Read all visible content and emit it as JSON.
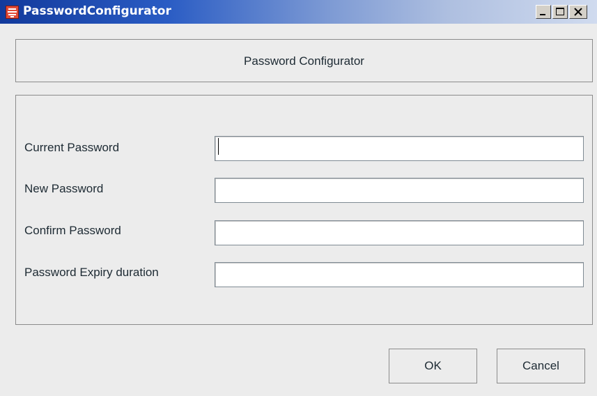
{
  "window": {
    "title": "PasswordConfigurator",
    "app_icon": "red-app-icon",
    "controls": {
      "minimize_icon": "minimize-icon",
      "maximize_icon": "maximize-icon",
      "close_icon": "close-icon"
    }
  },
  "header": {
    "title": "Password Configurator"
  },
  "form": {
    "fields": [
      {
        "label": "Current Password",
        "value": ""
      },
      {
        "label": "New Password",
        "value": ""
      },
      {
        "label": "Confirm Password",
        "value": ""
      },
      {
        "label": "Password Expiry duration",
        "value": ""
      }
    ]
  },
  "buttons": {
    "ok_label": "OK",
    "cancel_label": "Cancel"
  },
  "colors": {
    "titlebar_start": "#123a9c",
    "titlebar_end": "#d0dbef",
    "window_bg": "#ececec",
    "app_icon": "#e24a37"
  }
}
